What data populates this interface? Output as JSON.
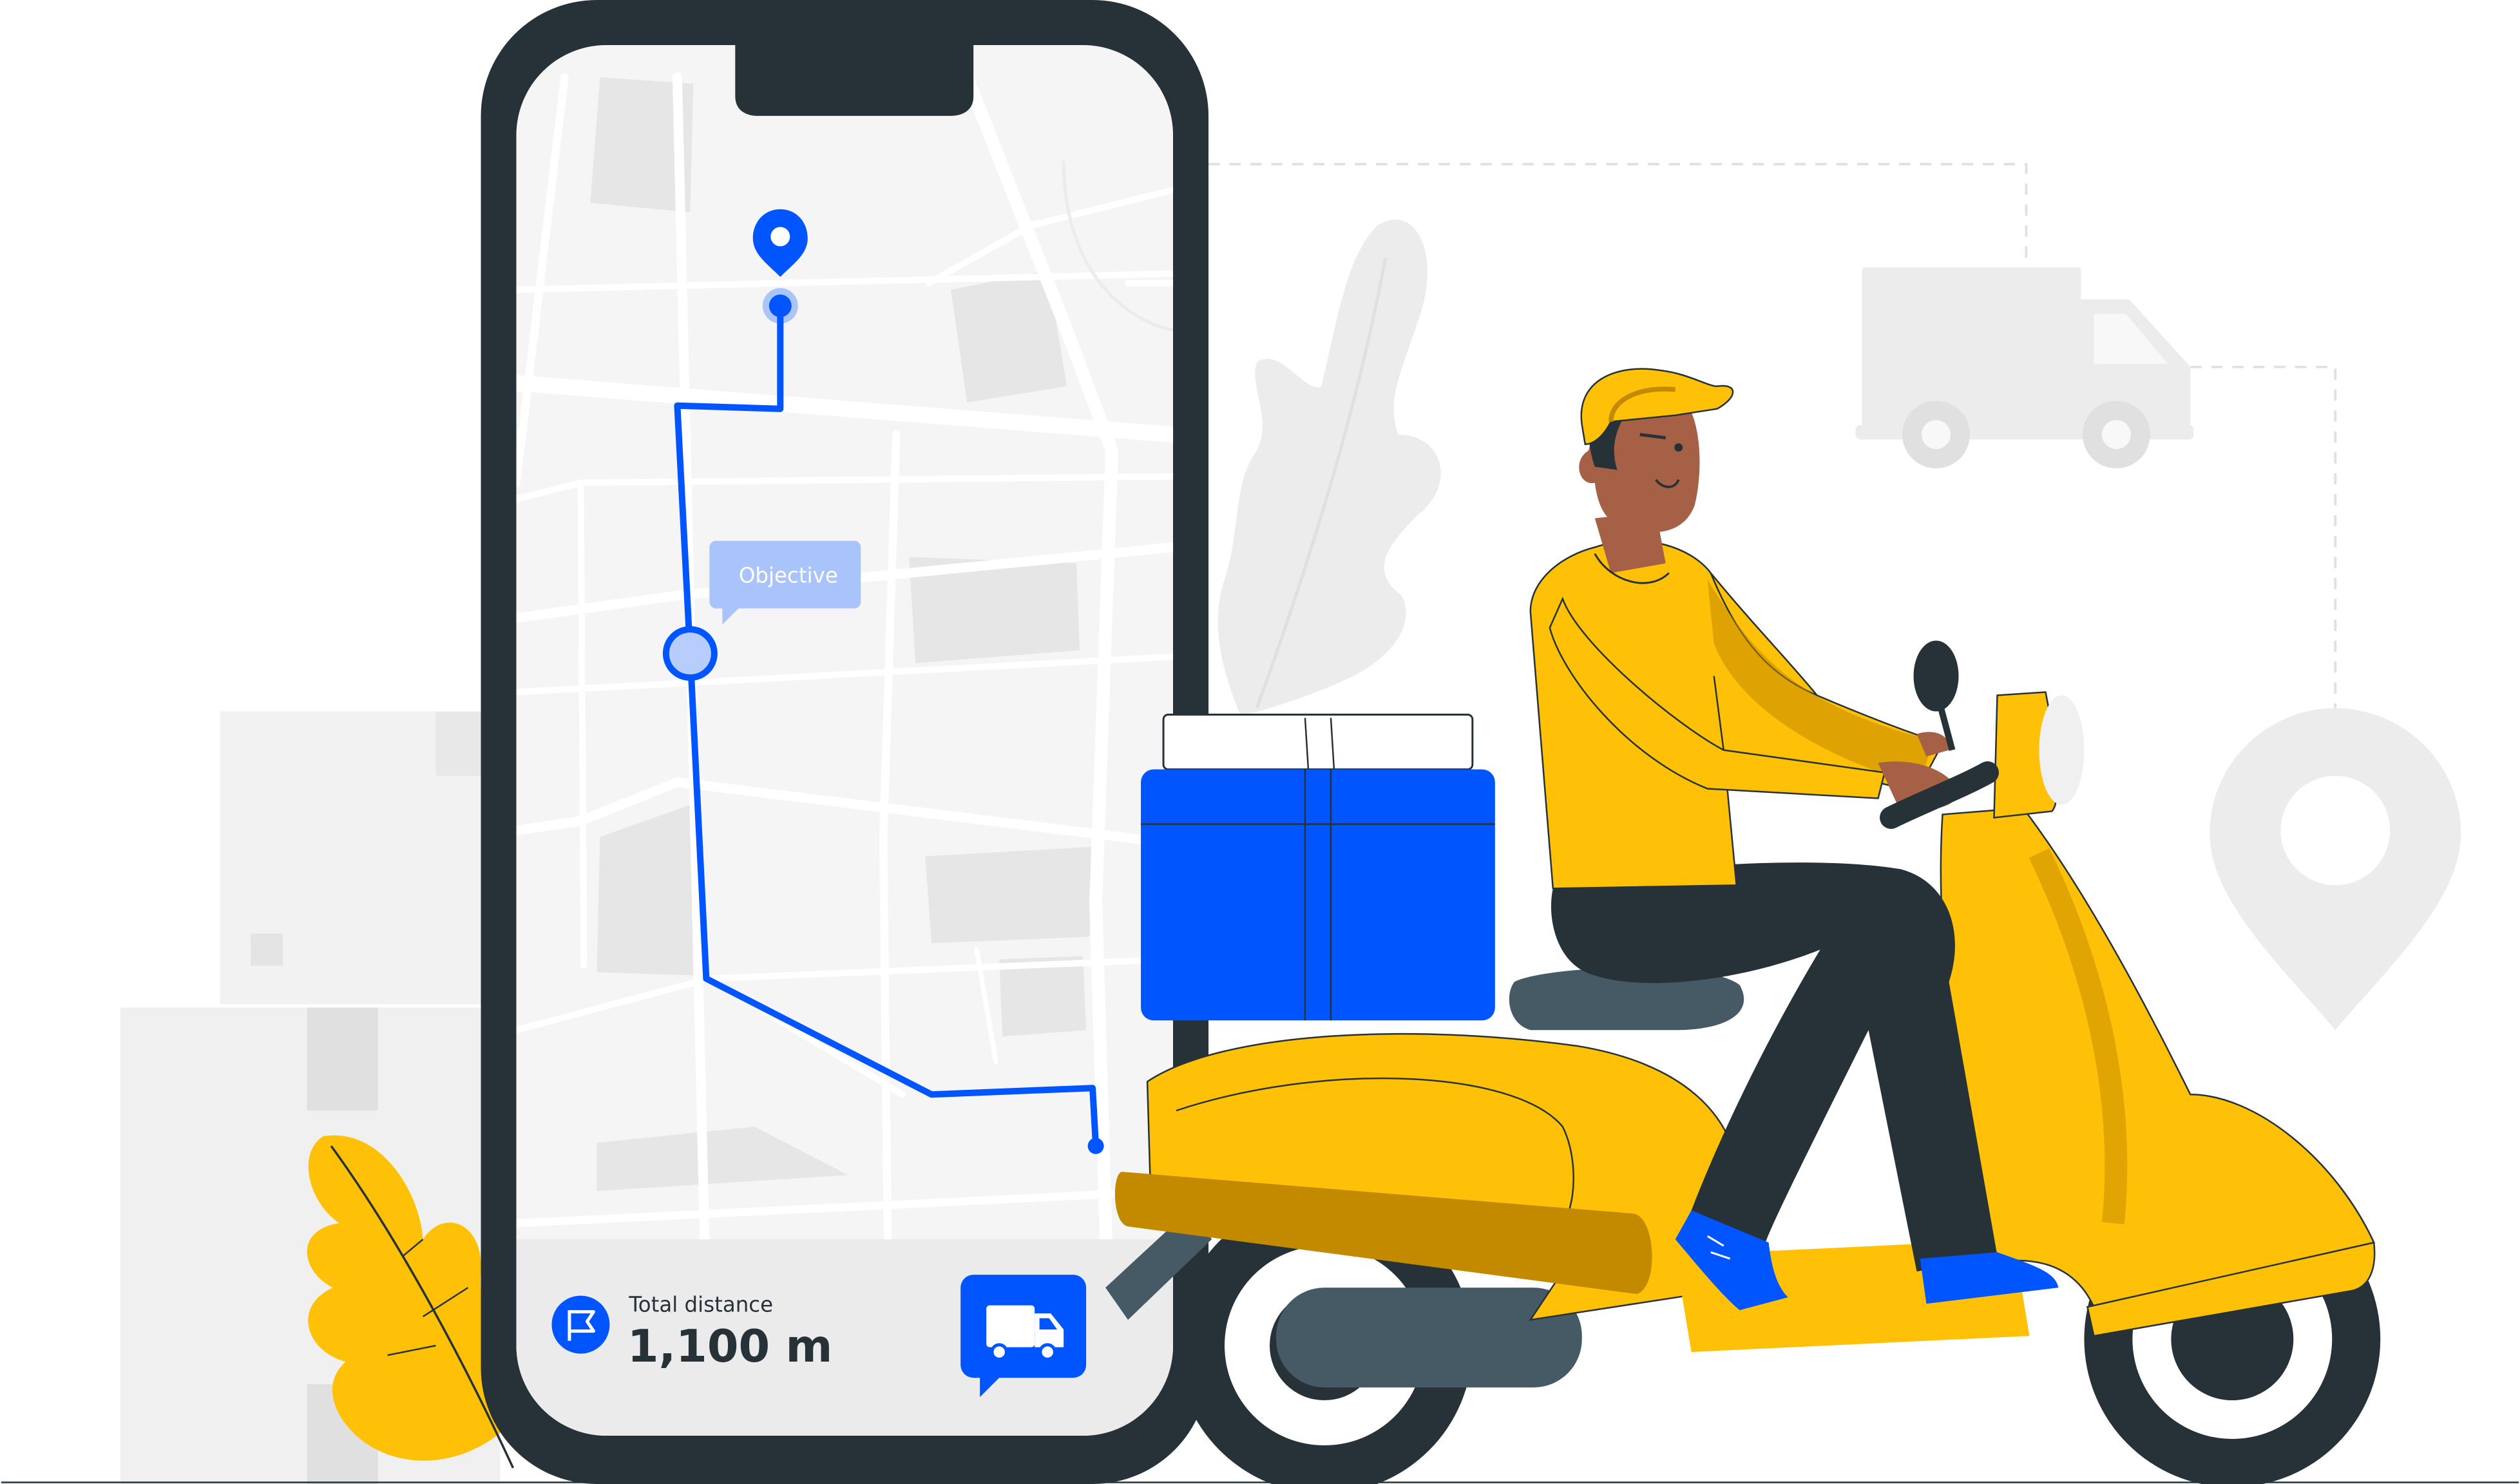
{
  "map": {
    "callout_label": "Objective"
  },
  "summary": {
    "title": "Total distance",
    "value": "1,100 m"
  },
  "icons": {
    "destination_pin": "map-pin-icon",
    "flag": "flag-icon",
    "delivery_truck": "truck-icon"
  },
  "colors": {
    "phone_frame": "#263238",
    "route": "#0055ff",
    "scooter_yellow": "#ffc107",
    "scooter_shade": "#c38a00",
    "map_background": "#f5f5f5",
    "delivery_box": "#0055ff"
  }
}
